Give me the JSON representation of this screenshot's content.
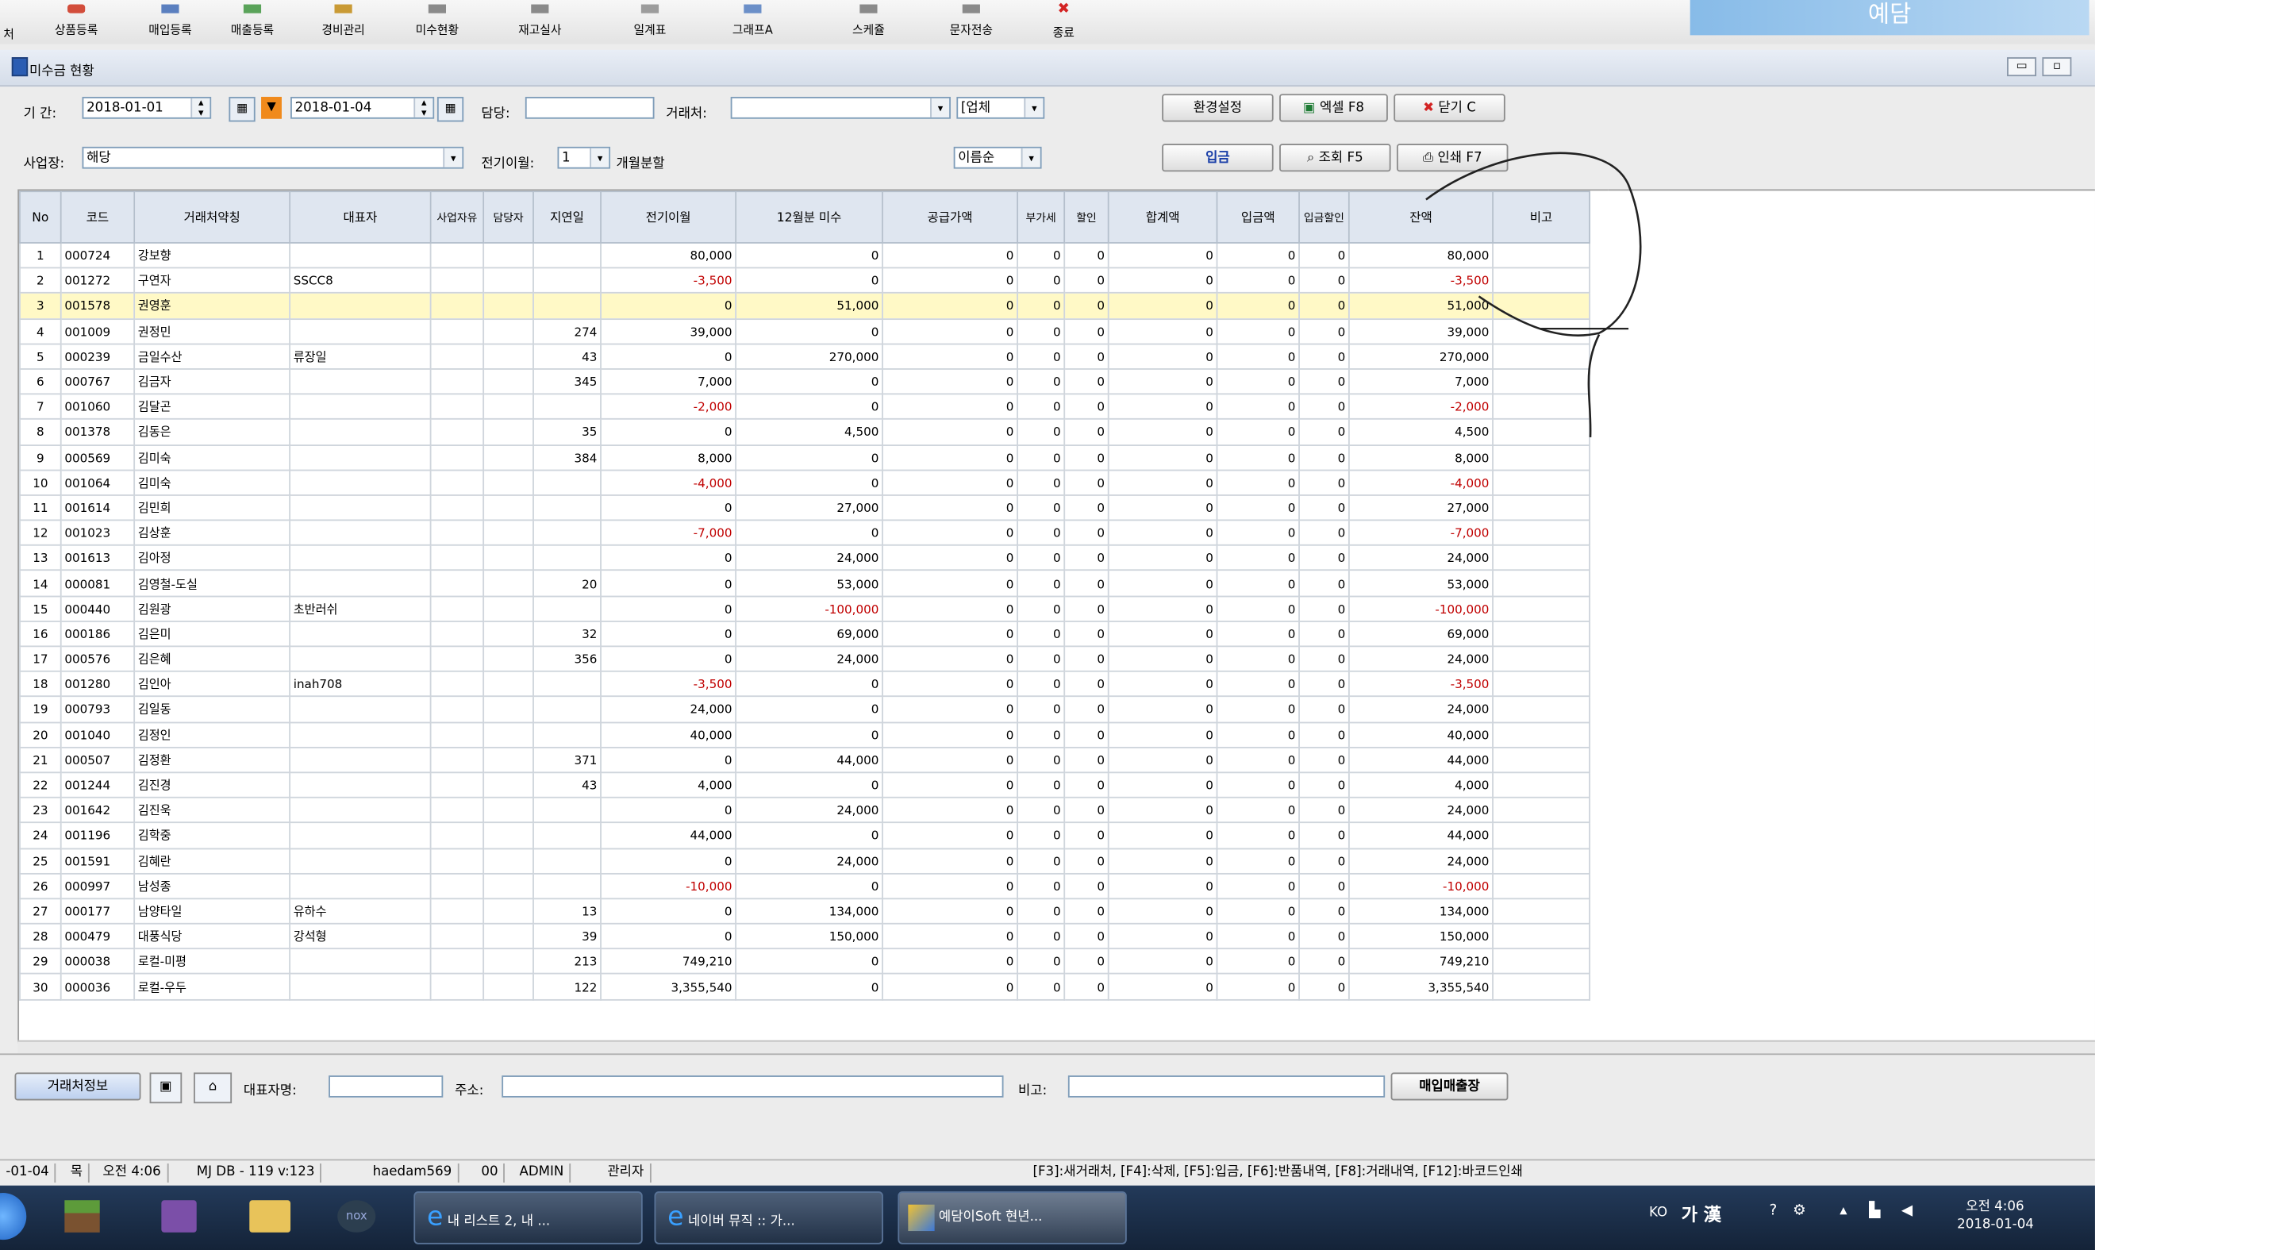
{
  "toolbar": {
    "partial_first": "처",
    "items": [
      "상품등록",
      "매입등록",
      "매출등록",
      "경비관리",
      "미수현황",
      "재고실사",
      "일계표",
      "그래프A",
      "스케쥴",
      "문자전송",
      "종료"
    ],
    "brand_text": "예담"
  },
  "window": {
    "title": "미수금 현황"
  },
  "filters": {
    "period_label": "기 간:",
    "date_from": "2018-01-01",
    "date_to": "2018-01-04",
    "manager_label": "담당:",
    "manager_value": "",
    "client_label": "거래처:",
    "client_value": "",
    "type_value": "[업체",
    "settings_button": "환경설정",
    "excel_button": "엑셀 F8",
    "close_button": "닫기 C",
    "workplace_label": "사업장:",
    "workplace_value": "해당",
    "prev_month_label": "전기이월:",
    "prev_month_value": "1",
    "monthly_label": "개월분할",
    "sort_value": "이름순",
    "deposit_button": "입금",
    "search_button": "조회 F5",
    "print_button": "인쇄 F7"
  },
  "grid": {
    "headers": [
      "No",
      "코드",
      "거래처약칭",
      "대표자",
      "사업자유",
      "담당자",
      "지연일",
      "전기이월",
      "12월분 미수",
      "공급가액",
      "부가세",
      "할인",
      "합계액",
      "입금액",
      "입금할인",
      "잔액",
      "비고"
    ],
    "rows": [
      [
        "1",
        "000724",
        "강보향",
        "",
        "",
        "",
        "",
        "80,000",
        "0",
        "0",
        "0",
        "0",
        "0",
        "0",
        "0",
        "80,000",
        ""
      ],
      [
        "2",
        "001272",
        "구연자",
        "SSCC8",
        "",
        "",
        "",
        "-3,500",
        "0",
        "0",
        "0",
        "0",
        "0",
        "0",
        "0",
        "-3,500",
        ""
      ],
      [
        "3",
        "001578",
        "권영훈",
        "",
        "",
        "",
        "",
        "0",
        "51,000",
        "0",
        "0",
        "0",
        "0",
        "0",
        "0",
        "51,000",
        ""
      ],
      [
        "4",
        "001009",
        "권정민",
        "",
        "",
        "",
        "274",
        "39,000",
        "0",
        "0",
        "0",
        "0",
        "0",
        "0",
        "0",
        "39,000",
        ""
      ],
      [
        "5",
        "000239",
        "금일수산",
        "류장일",
        "",
        "",
        "43",
        "0",
        "270,000",
        "0",
        "0",
        "0",
        "0",
        "0",
        "0",
        "270,000",
        ""
      ],
      [
        "6",
        "000767",
        "김금자",
        "",
        "",
        "",
        "345",
        "7,000",
        "0",
        "0",
        "0",
        "0",
        "0",
        "0",
        "0",
        "7,000",
        ""
      ],
      [
        "7",
        "001060",
        "김달곤",
        "",
        "",
        "",
        "",
        "-2,000",
        "0",
        "0",
        "0",
        "0",
        "0",
        "0",
        "0",
        "-2,000",
        ""
      ],
      [
        "8",
        "001378",
        "김동은",
        "",
        "",
        "",
        "35",
        "0",
        "4,500",
        "0",
        "0",
        "0",
        "0",
        "0",
        "0",
        "4,500",
        ""
      ],
      [
        "9",
        "000569",
        "김미숙",
        "",
        "",
        "",
        "384",
        "8,000",
        "0",
        "0",
        "0",
        "0",
        "0",
        "0",
        "0",
        "8,000",
        ""
      ],
      [
        "10",
        "001064",
        "김미숙",
        "",
        "",
        "",
        "",
        "-4,000",
        "0",
        "0",
        "0",
        "0",
        "0",
        "0",
        "0",
        "-4,000",
        ""
      ],
      [
        "11",
        "001614",
        "김민희",
        "",
        "",
        "",
        "",
        "0",
        "27,000",
        "0",
        "0",
        "0",
        "0",
        "0",
        "0",
        "27,000",
        ""
      ],
      [
        "12",
        "001023",
        "김상훈",
        "",
        "",
        "",
        "",
        "-7,000",
        "0",
        "0",
        "0",
        "0",
        "0",
        "0",
        "0",
        "-7,000",
        ""
      ],
      [
        "13",
        "001613",
        "김아정",
        "",
        "",
        "",
        "",
        "0",
        "24,000",
        "0",
        "0",
        "0",
        "0",
        "0",
        "0",
        "24,000",
        ""
      ],
      [
        "14",
        "000081",
        "김영철-도실",
        "",
        "",
        "",
        "20",
        "0",
        "53,000",
        "0",
        "0",
        "0",
        "0",
        "0",
        "0",
        "53,000",
        ""
      ],
      [
        "15",
        "000440",
        "김원광",
        "초반러쉬",
        "",
        "",
        "",
        "0",
        "-100,000",
        "0",
        "0",
        "0",
        "0",
        "0",
        "0",
        "-100,000",
        ""
      ],
      [
        "16",
        "000186",
        "김은미",
        "",
        "",
        "",
        "32",
        "0",
        "69,000",
        "0",
        "0",
        "0",
        "0",
        "0",
        "0",
        "69,000",
        ""
      ],
      [
        "17",
        "000576",
        "김은혜",
        "",
        "",
        "",
        "356",
        "0",
        "24,000",
        "0",
        "0",
        "0",
        "0",
        "0",
        "0",
        "24,000",
        ""
      ],
      [
        "18",
        "001280",
        "김인아",
        "inah708",
        "",
        "",
        "",
        "-3,500",
        "0",
        "0",
        "0",
        "0",
        "0",
        "0",
        "0",
        "-3,500",
        ""
      ],
      [
        "19",
        "000793",
        "김일동",
        "",
        "",
        "",
        "",
        "24,000",
        "0",
        "0",
        "0",
        "0",
        "0",
        "0",
        "0",
        "24,000",
        ""
      ],
      [
        "20",
        "001040",
        "김정인",
        "",
        "",
        "",
        "",
        "40,000",
        "0",
        "0",
        "0",
        "0",
        "0",
        "0",
        "0",
        "40,000",
        ""
      ],
      [
        "21",
        "000507",
        "김정환",
        "",
        "",
        "",
        "371",
        "0",
        "44,000",
        "0",
        "0",
        "0",
        "0",
        "0",
        "0",
        "44,000",
        ""
      ],
      [
        "22",
        "001244",
        "김진경",
        "",
        "",
        "",
        "43",
        "4,000",
        "0",
        "0",
        "0",
        "0",
        "0",
        "0",
        "0",
        "4,000",
        ""
      ],
      [
        "23",
        "001642",
        "김진욱",
        "",
        "",
        "",
        "",
        "0",
        "24,000",
        "0",
        "0",
        "0",
        "0",
        "0",
        "0",
        "24,000",
        ""
      ],
      [
        "24",
        "001196",
        "김학중",
        "",
        "",
        "",
        "",
        "44,000",
        "0",
        "0",
        "0",
        "0",
        "0",
        "0",
        "0",
        "44,000",
        ""
      ],
      [
        "25",
        "001591",
        "김혜란",
        "",
        "",
        "",
        "",
        "0",
        "24,000",
        "0",
        "0",
        "0",
        "0",
        "0",
        "0",
        "24,000",
        ""
      ],
      [
        "26",
        "000997",
        "남성종",
        "",
        "",
        "",
        "",
        "-10,000",
        "0",
        "0",
        "0",
        "0",
        "0",
        "0",
        "0",
        "-10,000",
        ""
      ],
      [
        "27",
        "000177",
        "남양타일",
        "유하수",
        "",
        "",
        "13",
        "0",
        "134,000",
        "0",
        "0",
        "0",
        "0",
        "0",
        "0",
        "134,000",
        ""
      ],
      [
        "28",
        "000479",
        "대풍식당",
        "강석형",
        "",
        "",
        "39",
        "0",
        "150,000",
        "0",
        "0",
        "0",
        "0",
        "0",
        "0",
        "150,000",
        ""
      ],
      [
        "29",
        "000038",
        "로컬-미평",
        "",
        "",
        "",
        "213",
        "749,210",
        "0",
        "0",
        "0",
        "0",
        "0",
        "0",
        "0",
        "749,210",
        ""
      ],
      [
        "30",
        "000036",
        "로컬-우두",
        "",
        "",
        "",
        "122",
        "3,355,540",
        "0",
        "0",
        "0",
        "0",
        "0",
        "0",
        "0",
        "3,355,540",
        ""
      ]
    ]
  },
  "bottom": {
    "client_info_button": "거래처정보",
    "rep_label": "대표자명:",
    "rep_value": "",
    "address_label": "주소:",
    "address_value": "",
    "memo_label": "비고:",
    "memo_value": "",
    "ledger_button": "매입매출장"
  },
  "status": {
    "items": [
      "-01-04",
      "목",
      "오전 4:06",
      "MJ DB - 119 v:123",
      "haedam569",
      "00",
      "ADMIN",
      "관리자"
    ],
    "hint": "[F3]:새거래처, [F4]:삭제, [F5]:입금, [F6]:반품내역, [F8]:거래내역, [F12]:바코드인쇄"
  },
  "taskbar": {
    "tasks": [
      "내 리스트 2, 내 ...",
      "네이버 뮤직 :: 가...",
      "예담이Soft 현년..."
    ],
    "ime": "KO",
    "ime_chars": "가 漢",
    "time": "오전 4:06",
    "date": "2018-01-04"
  },
  "colors": {
    "negative": "#c00000",
    "selected_row": "#fff9c6",
    "header": "#dfe6f0",
    "taskbar": "#1b2d47"
  }
}
